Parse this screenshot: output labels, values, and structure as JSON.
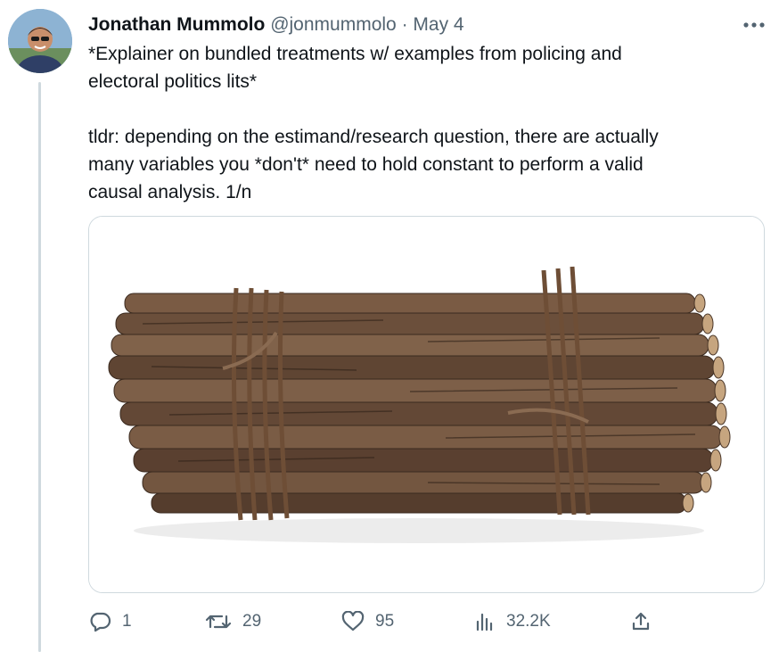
{
  "tweet": {
    "author_name": "Jonathan Mummolo",
    "handle": "@jonmummolo",
    "separator": "·",
    "date": "May 4",
    "text_lines": [
      "*Explainer on bundled treatments w/ examples from policing and",
      "electoral politics lits*",
      "",
      "tldr: depending on the estimand/research question, there are actually",
      "many variables you *don't* need to hold constant to perform a valid",
      "causal analysis. 1/n"
    ]
  },
  "media": {
    "icon": "bundle-of-sticks-image"
  },
  "actions": {
    "reply": {
      "icon": "reply-icon",
      "count": "1"
    },
    "retweet": {
      "icon": "retweet-icon",
      "count": "29"
    },
    "like": {
      "icon": "heart-icon",
      "count": "95"
    },
    "views": {
      "icon": "views-icon",
      "count": "32.2K"
    },
    "share": {
      "icon": "share-icon"
    }
  },
  "colors": {
    "text": "#0f1419",
    "muted": "#536471",
    "border": "#cfd9de"
  }
}
